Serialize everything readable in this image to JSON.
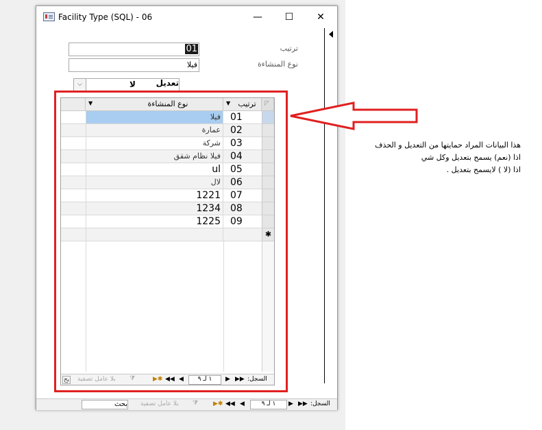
{
  "window": {
    "title": "Facility Type (SQL) - 06",
    "minimize": "—",
    "maximize": "☐",
    "close": "✕"
  },
  "form": {
    "order_label": "ترتيب",
    "order_value": "01",
    "type_label": "نوع المنشاءة",
    "type_value": "فيلا",
    "edit_label": "تعديل",
    "edit_value": "لا"
  },
  "datasheet": {
    "col_order": "ترتيب",
    "col_type": "نوع المنشاءة",
    "rows": [
      {
        "order": "01",
        "type": "فيلا"
      },
      {
        "order": "02",
        "type": "عمارة"
      },
      {
        "order": "03",
        "type": "شركة"
      },
      {
        "order": "04",
        "type": "فيلا نظام شقق"
      },
      {
        "order": "05",
        "type": "ul"
      },
      {
        "order": "06",
        "type": "لال"
      },
      {
        "order": "07",
        "type": "1221"
      },
      {
        "order": "08",
        "type": "1234"
      },
      {
        "order": "09",
        "type": "1225"
      }
    ],
    "new_row_marker": "✱",
    "nav": {
      "record_label": "السجل:",
      "position": "١ لـ ٩",
      "filter": "بلا عامل تصفية",
      "search": "بح"
    }
  },
  "form_nav": {
    "record_label": "السجل:",
    "position": "١ لـ ٩",
    "filter": "بلا عامل تصفية",
    "search": "بحث"
  },
  "note": {
    "line1": "هذا البيانات المراد حمايتها من التعديل و الحذف",
    "line2": "اذا (نعم) يسمح بتعديل وكل شي",
    "line3": "اذا (لا ) لايسمح بتعديل ."
  },
  "colors": {
    "accent_red": "#e02020",
    "selection": "#a8cdf0"
  }
}
